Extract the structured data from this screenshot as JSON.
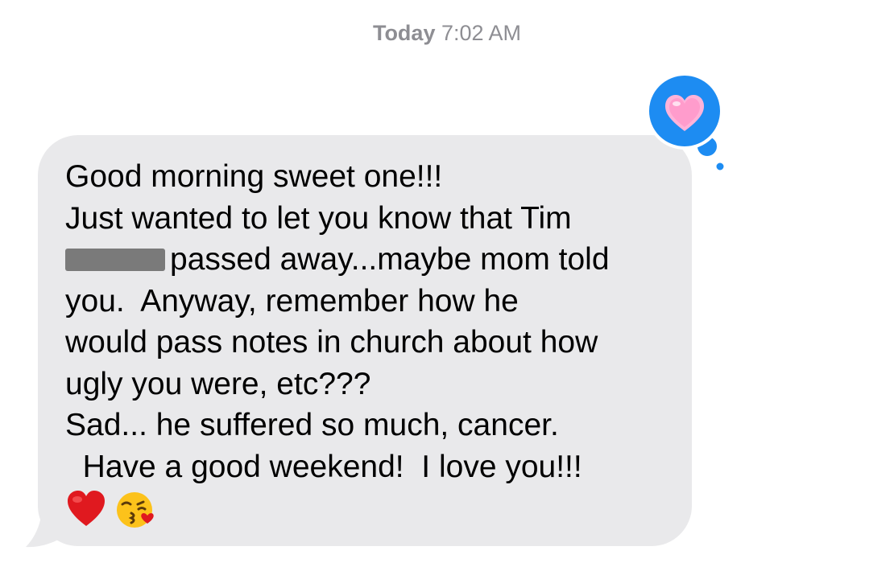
{
  "timestamp": {
    "day": "Today",
    "time": "7:02 AM"
  },
  "message": {
    "line1": "Good morning sweet one!!!",
    "line2": "Just wanted to let you know that Tim",
    "line3": "passed away...maybe mom told",
    "line4": "you.  Anyway, remember how he",
    "line5": "would pass notes in church about how",
    "line6": "ugly you were, etc???",
    "line7": "Sad... he suffered so much, cancer.",
    "line8": "  Have a good weekend!  I love you!!!",
    "emojis": [
      "red-heart-icon",
      "face-blowing-kiss-icon"
    ]
  },
  "reaction": {
    "icon": "pink-heart-icon",
    "bubble_color": "#1d8cf2"
  },
  "colors": {
    "incoming_bubble": "#e9e9eb",
    "timestamp_text": "#8e8e93"
  }
}
